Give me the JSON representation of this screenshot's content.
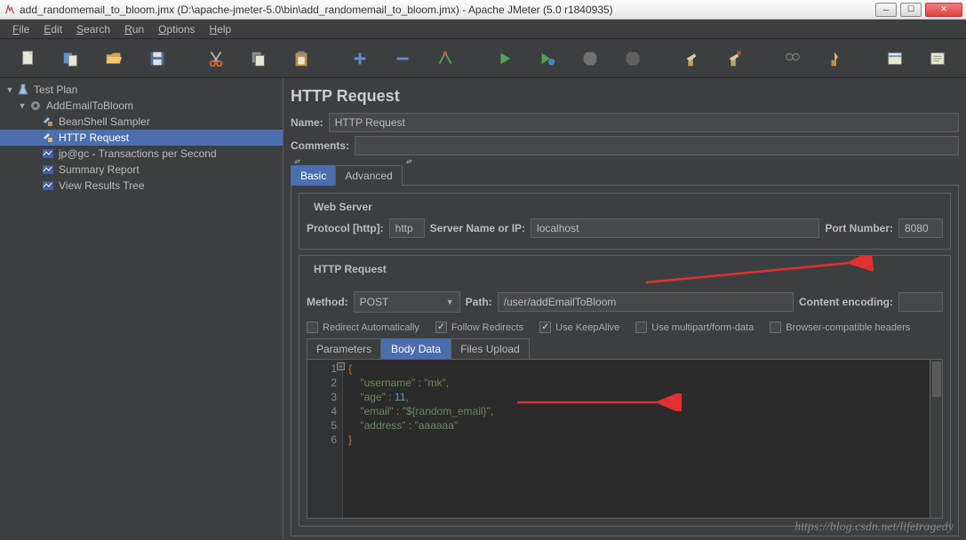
{
  "window": {
    "title": "add_randomemail_to_bloom.jmx (D:\\apache-jmeter-5.0\\bin\\add_randomemail_to_bloom.jmx) - Apache JMeter (5.0 r1840935)"
  },
  "menu": [
    "File",
    "Edit",
    "Search",
    "Run",
    "Options",
    "Help"
  ],
  "tree": {
    "root": "Test Plan",
    "group": "AddEmailToBloom",
    "items": [
      "BeanShell Sampler",
      "HTTP Request",
      "jp@gc - Transactions per Second",
      "Summary Report",
      "View Results Tree"
    ],
    "selected": "HTTP Request"
  },
  "panel": {
    "title": "HTTP Request",
    "name_label": "Name:",
    "name_value": "HTTP Request",
    "comments_label": "Comments:",
    "tabs": {
      "basic": "Basic",
      "advanced": "Advanced"
    },
    "webserver": {
      "legend": "Web Server",
      "protocol_label": "Protocol [http]:",
      "protocol": "http",
      "server_label": "Server Name or IP:",
      "server": "localhost",
      "port_label": "Port Number:",
      "port": "8080"
    },
    "httpreq": {
      "legend": "HTTP Request",
      "method_label": "Method:",
      "method": "POST",
      "path_label": "Path:",
      "path": "/user/addEmailToBloom",
      "encoding_label": "Content encoding:",
      "encoding": ""
    },
    "checks": {
      "redirect_auto": "Redirect Automatically",
      "follow": "Follow Redirects",
      "keepalive": "Use KeepAlive",
      "multipart": "Use multipart/form-data",
      "browser": "Browser-compatible headers"
    },
    "body_tabs": {
      "params": "Parameters",
      "body": "Body Data",
      "files": "Files Upload"
    },
    "code": {
      "l1": "{",
      "l2": "    \"username\" : \"mk\",",
      "l3": "    \"age\" : 11,",
      "l4": "    \"email\" : \"${random_email}\",",
      "l5": "    \"address\" : \"aaaaaa\"",
      "l6": "}"
    }
  },
  "watermark": "https://blog.csdn.net/lifetragedy"
}
